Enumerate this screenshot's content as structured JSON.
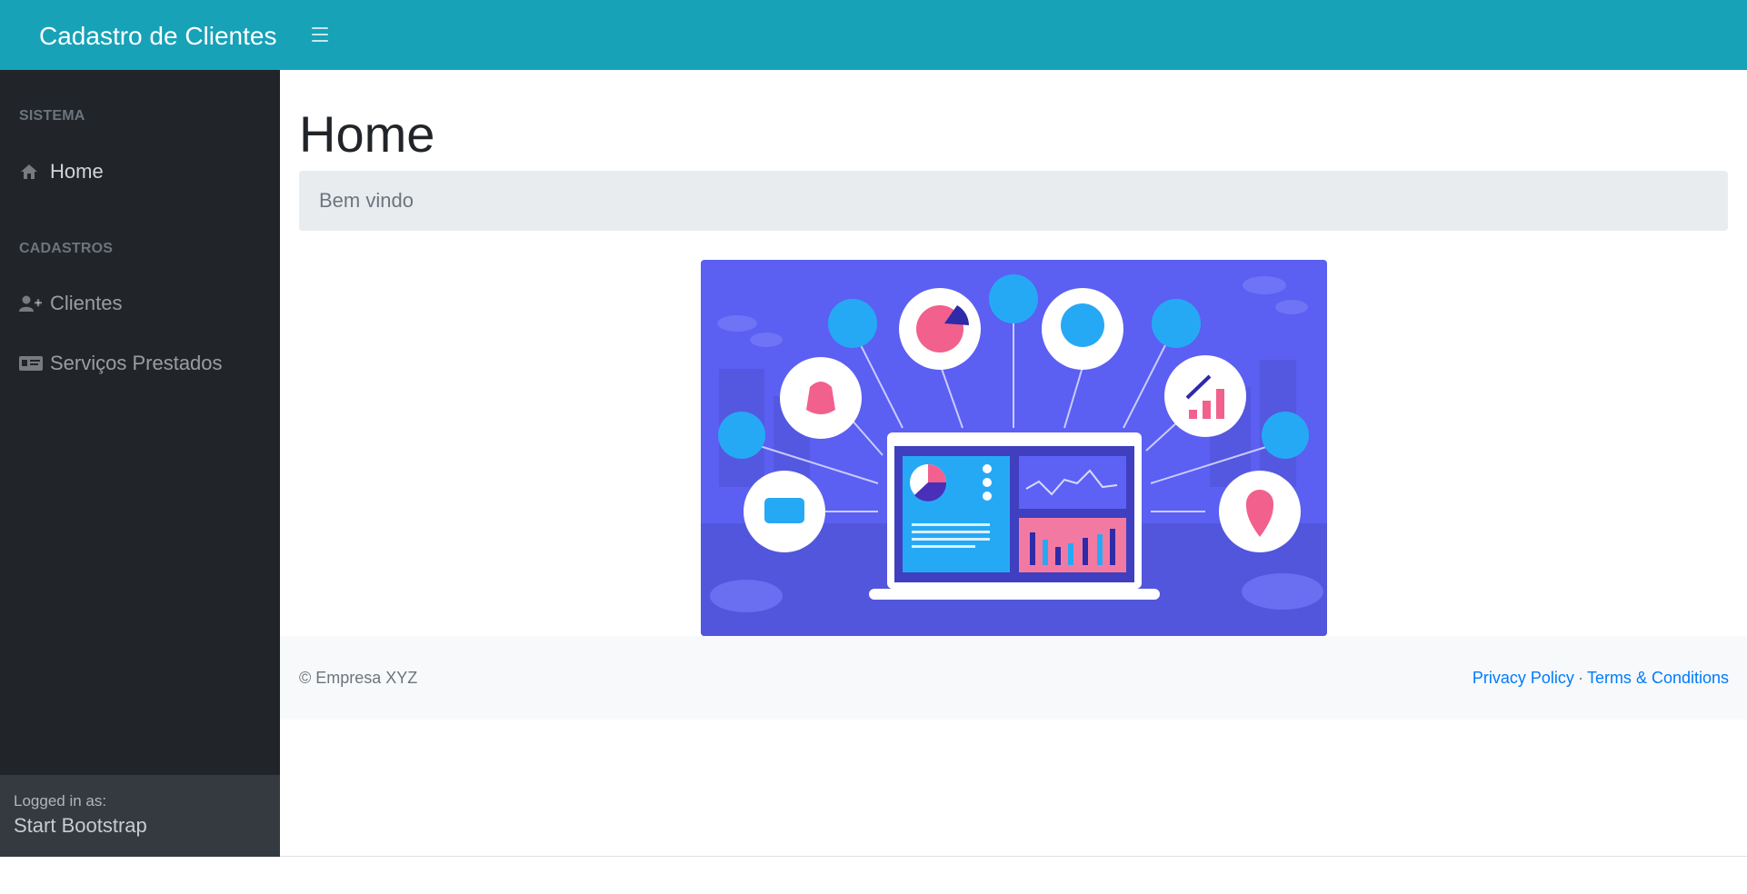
{
  "topnav": {
    "brand": "Cadastro de Clientes",
    "toggle_icon": "hamburger-icon",
    "bg_color": "#17a2b8"
  },
  "sidebar": {
    "headings": [
      "SISTEMA",
      "CADASTROS"
    ],
    "items": [
      {
        "label": "Home",
        "icon": "home-icon"
      },
      {
        "label": "Clientes",
        "icon": "user-plus-icon"
      },
      {
        "label": "Serviços Prestados",
        "icon": "id-card-icon"
      }
    ],
    "footer": {
      "logged_label": "Logged in as:",
      "user": "Start Bootstrap"
    }
  },
  "main": {
    "title": "Home",
    "breadcrumb": "Bem vindo",
    "hero_image": "dashboard-illustration"
  },
  "footer": {
    "copyright": "© Empresa XYZ",
    "privacy": "Privacy Policy",
    "separator": "·",
    "terms": "Terms & Conditions"
  }
}
